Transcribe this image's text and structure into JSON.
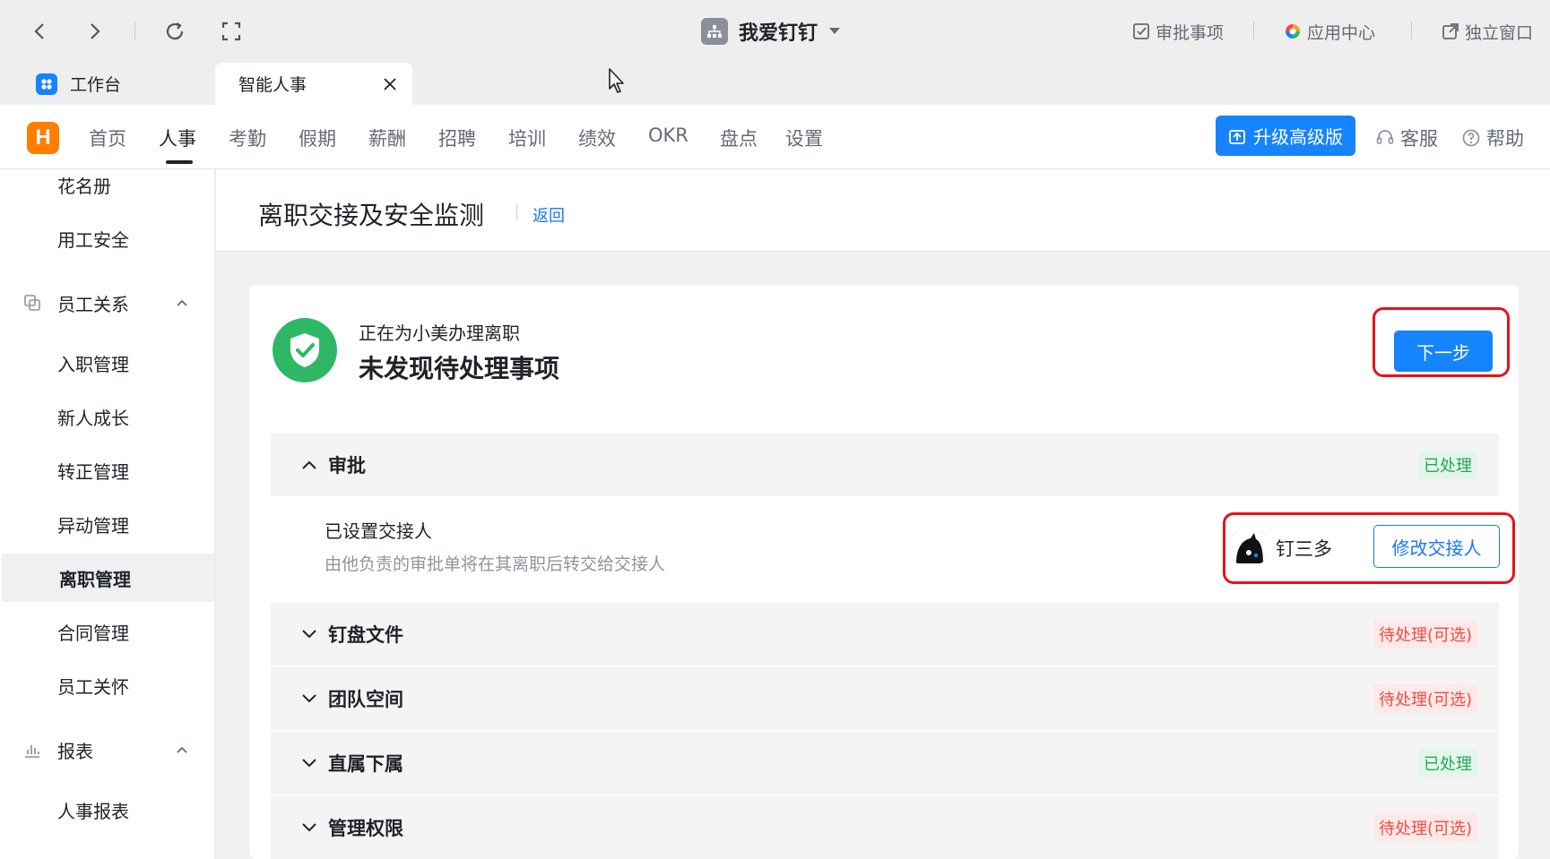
{
  "window": {
    "org_name": "我爱钉钉",
    "links": {
      "approval": "审批事项",
      "app_center": "应用中心",
      "standalone": "独立窗口"
    }
  },
  "tabs": [
    {
      "label": "工作台"
    },
    {
      "label": "智能人事"
    }
  ],
  "appnav": {
    "logo_letter": "H",
    "items": [
      "首页",
      "人事",
      "考勤",
      "假期",
      "薪酬",
      "招聘",
      "培训",
      "绩效",
      "OKR",
      "盘点",
      "设置"
    ],
    "active": "人事",
    "upgrade_label": "升级高级版",
    "service_label": "客服",
    "help_label": "帮助"
  },
  "sidebar": {
    "items_top": [
      "花名册",
      "用工安全"
    ],
    "group_relations": "员工关系",
    "relations_items": [
      "入职管理",
      "新人成长",
      "转正管理",
      "异动管理",
      "离职管理",
      "合同管理",
      "员工关怀"
    ],
    "active": "离职管理",
    "group_reports": "报表",
    "reports_items": [
      "人事报表"
    ]
  },
  "page": {
    "title": "离职交接及安全监测",
    "back_label": "返回"
  },
  "status": {
    "subtitle": "正在为小美办理离职",
    "headline": "未发现待处理事项",
    "next_label": "下一步"
  },
  "sections": [
    {
      "label": "审批",
      "status": "已处理",
      "state": "done",
      "expanded": true
    },
    {
      "label": "钉盘文件",
      "status": "待处理(可选)",
      "state": "todo",
      "expanded": false
    },
    {
      "label": "团队空间",
      "status": "待处理(可选)",
      "state": "todo",
      "expanded": false
    },
    {
      "label": "直属下属",
      "status": "已处理",
      "state": "done",
      "expanded": false
    },
    {
      "label": "管理权限",
      "status": "待处理(可选)",
      "state": "todo",
      "expanded": false
    }
  ],
  "handover": {
    "title": "已设置交接人",
    "desc": "由他负责的审批单将在其离职后转交给交接人",
    "person": "钉三多",
    "change_label": "修改交接人"
  },
  "colors": {
    "primary": "#1683ff",
    "success": "#22a85a",
    "warning": "#f54a45",
    "highlight": "#e8121b"
  }
}
